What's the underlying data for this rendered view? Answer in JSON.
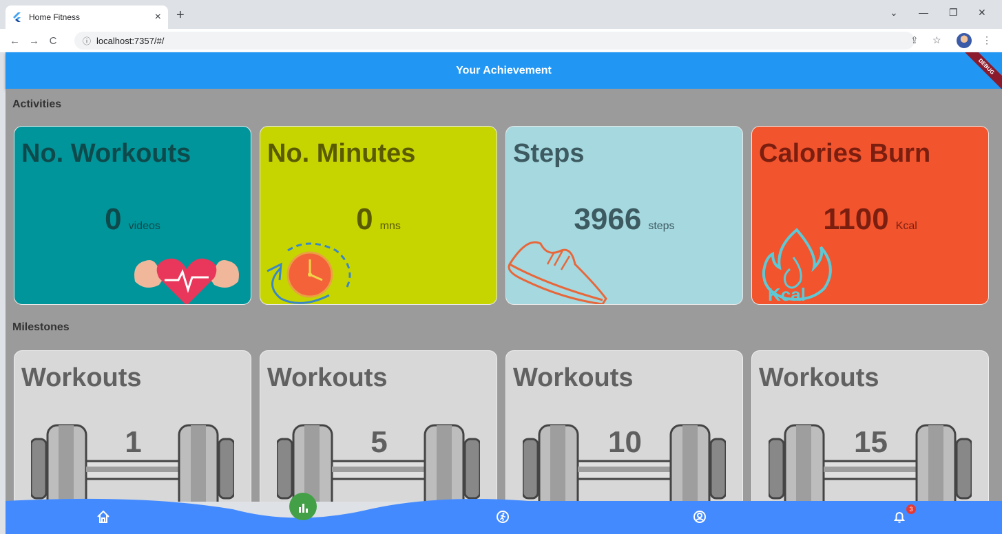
{
  "browser": {
    "tab_title": "Home Fitness",
    "tab_close": "×",
    "new_tab": "+",
    "url": "localhost:7357/#/",
    "back": "←",
    "forward": "→",
    "reload": "C",
    "info": "ⓘ",
    "share": "⇪",
    "bookmark": "☆",
    "menu": "⋮",
    "minimize": "—",
    "restore": "❐",
    "close": "✕",
    "tab_search": "⌄"
  },
  "appbar": {
    "title": "Your Achievement",
    "debug": "DEBUG"
  },
  "sections": {
    "activities": "Activities",
    "milestones": "Milestones"
  },
  "activities": [
    {
      "title": "No. Workouts",
      "value": "0",
      "unit": "videos",
      "bg": "#00959a",
      "fg": "#0e4a4c"
    },
    {
      "title": "No. Minutes",
      "value": "0",
      "unit": "mns",
      "bg": "#c6d500",
      "fg": "#5a5a00"
    },
    {
      "title": "Steps",
      "value": "3966",
      "unit": "steps",
      "bg": "#a5d8df",
      "fg": "#3d5a61"
    },
    {
      "title": "Calories Burn",
      "value": "1100",
      "unit": "Kcal",
      "bg": "#f2542d",
      "fg": "#7a1e10"
    }
  ],
  "activity_icon_texts": {
    "kcal": "Kcal"
  },
  "milestones": [
    {
      "title": "Workouts",
      "count": "1"
    },
    {
      "title": "Workouts",
      "count": "5"
    },
    {
      "title": "Workouts",
      "count": "10"
    },
    {
      "title": "Workouts",
      "count": "15"
    }
  ],
  "bottom_nav": {
    "notification_count": "3",
    "icons": [
      "home-icon",
      "stats-icon",
      "running-icon",
      "profile-icon",
      "bell-icon"
    ]
  }
}
